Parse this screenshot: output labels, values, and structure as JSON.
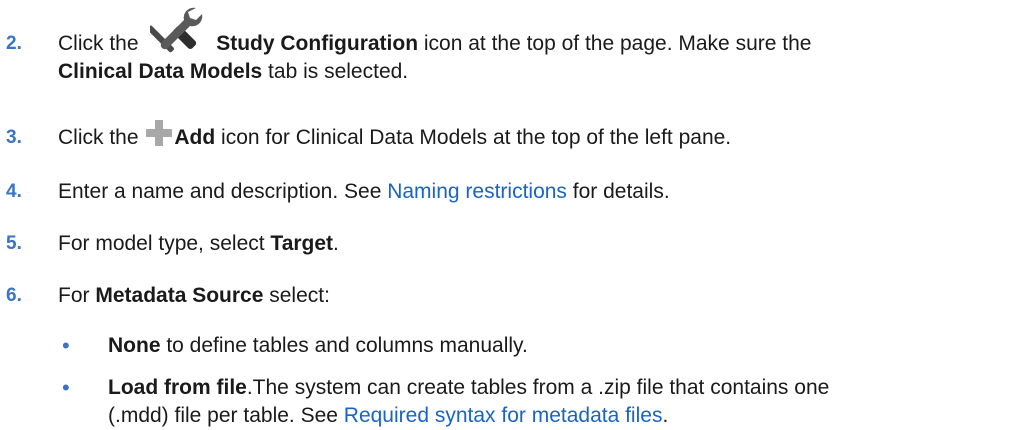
{
  "steps": [
    {
      "number": "2.",
      "line1_pre": "Click the",
      "icon1": "wrench-screwdriver-icon",
      "line1_bold": "Study Configuration",
      "line1_post": " icon at the top of the page. Make sure the",
      "line2_bold": "Clinical Data Models",
      "line2_post": " tab is selected."
    },
    {
      "number": "3.",
      "pre": "Click the ",
      "icon": "plus-icon",
      "bold": "Add",
      "post": " icon for Clinical Data Models at the top of the left pane."
    },
    {
      "number": "4.",
      "pre": "Enter a name and description. See ",
      "link": "Naming restrictions",
      "post": " for details."
    },
    {
      "number": "5.",
      "pre": "For model type, select ",
      "bold": "Target",
      "post": "."
    },
    {
      "number": "6.",
      "pre": "For ",
      "bold": "Metadata Source",
      "post": " select:"
    }
  ],
  "bullets": [
    {
      "marker": "•",
      "bold": "None",
      "post": " to define tables and columns manually."
    },
    {
      "marker": "•",
      "bold": "Load from file",
      "line1_post": ".The system can create tables from a .zip file that contains one",
      "line2_pre": "(.mdd) file per table. See ",
      "link": "Required syntax for metadata files",
      "line2_post": "."
    }
  ],
  "colors": {
    "step_number": "#3a74c4",
    "link": "#1a63c6",
    "icon_gray": "#4a4a4a",
    "plus_gray": "#a8a8a8"
  }
}
